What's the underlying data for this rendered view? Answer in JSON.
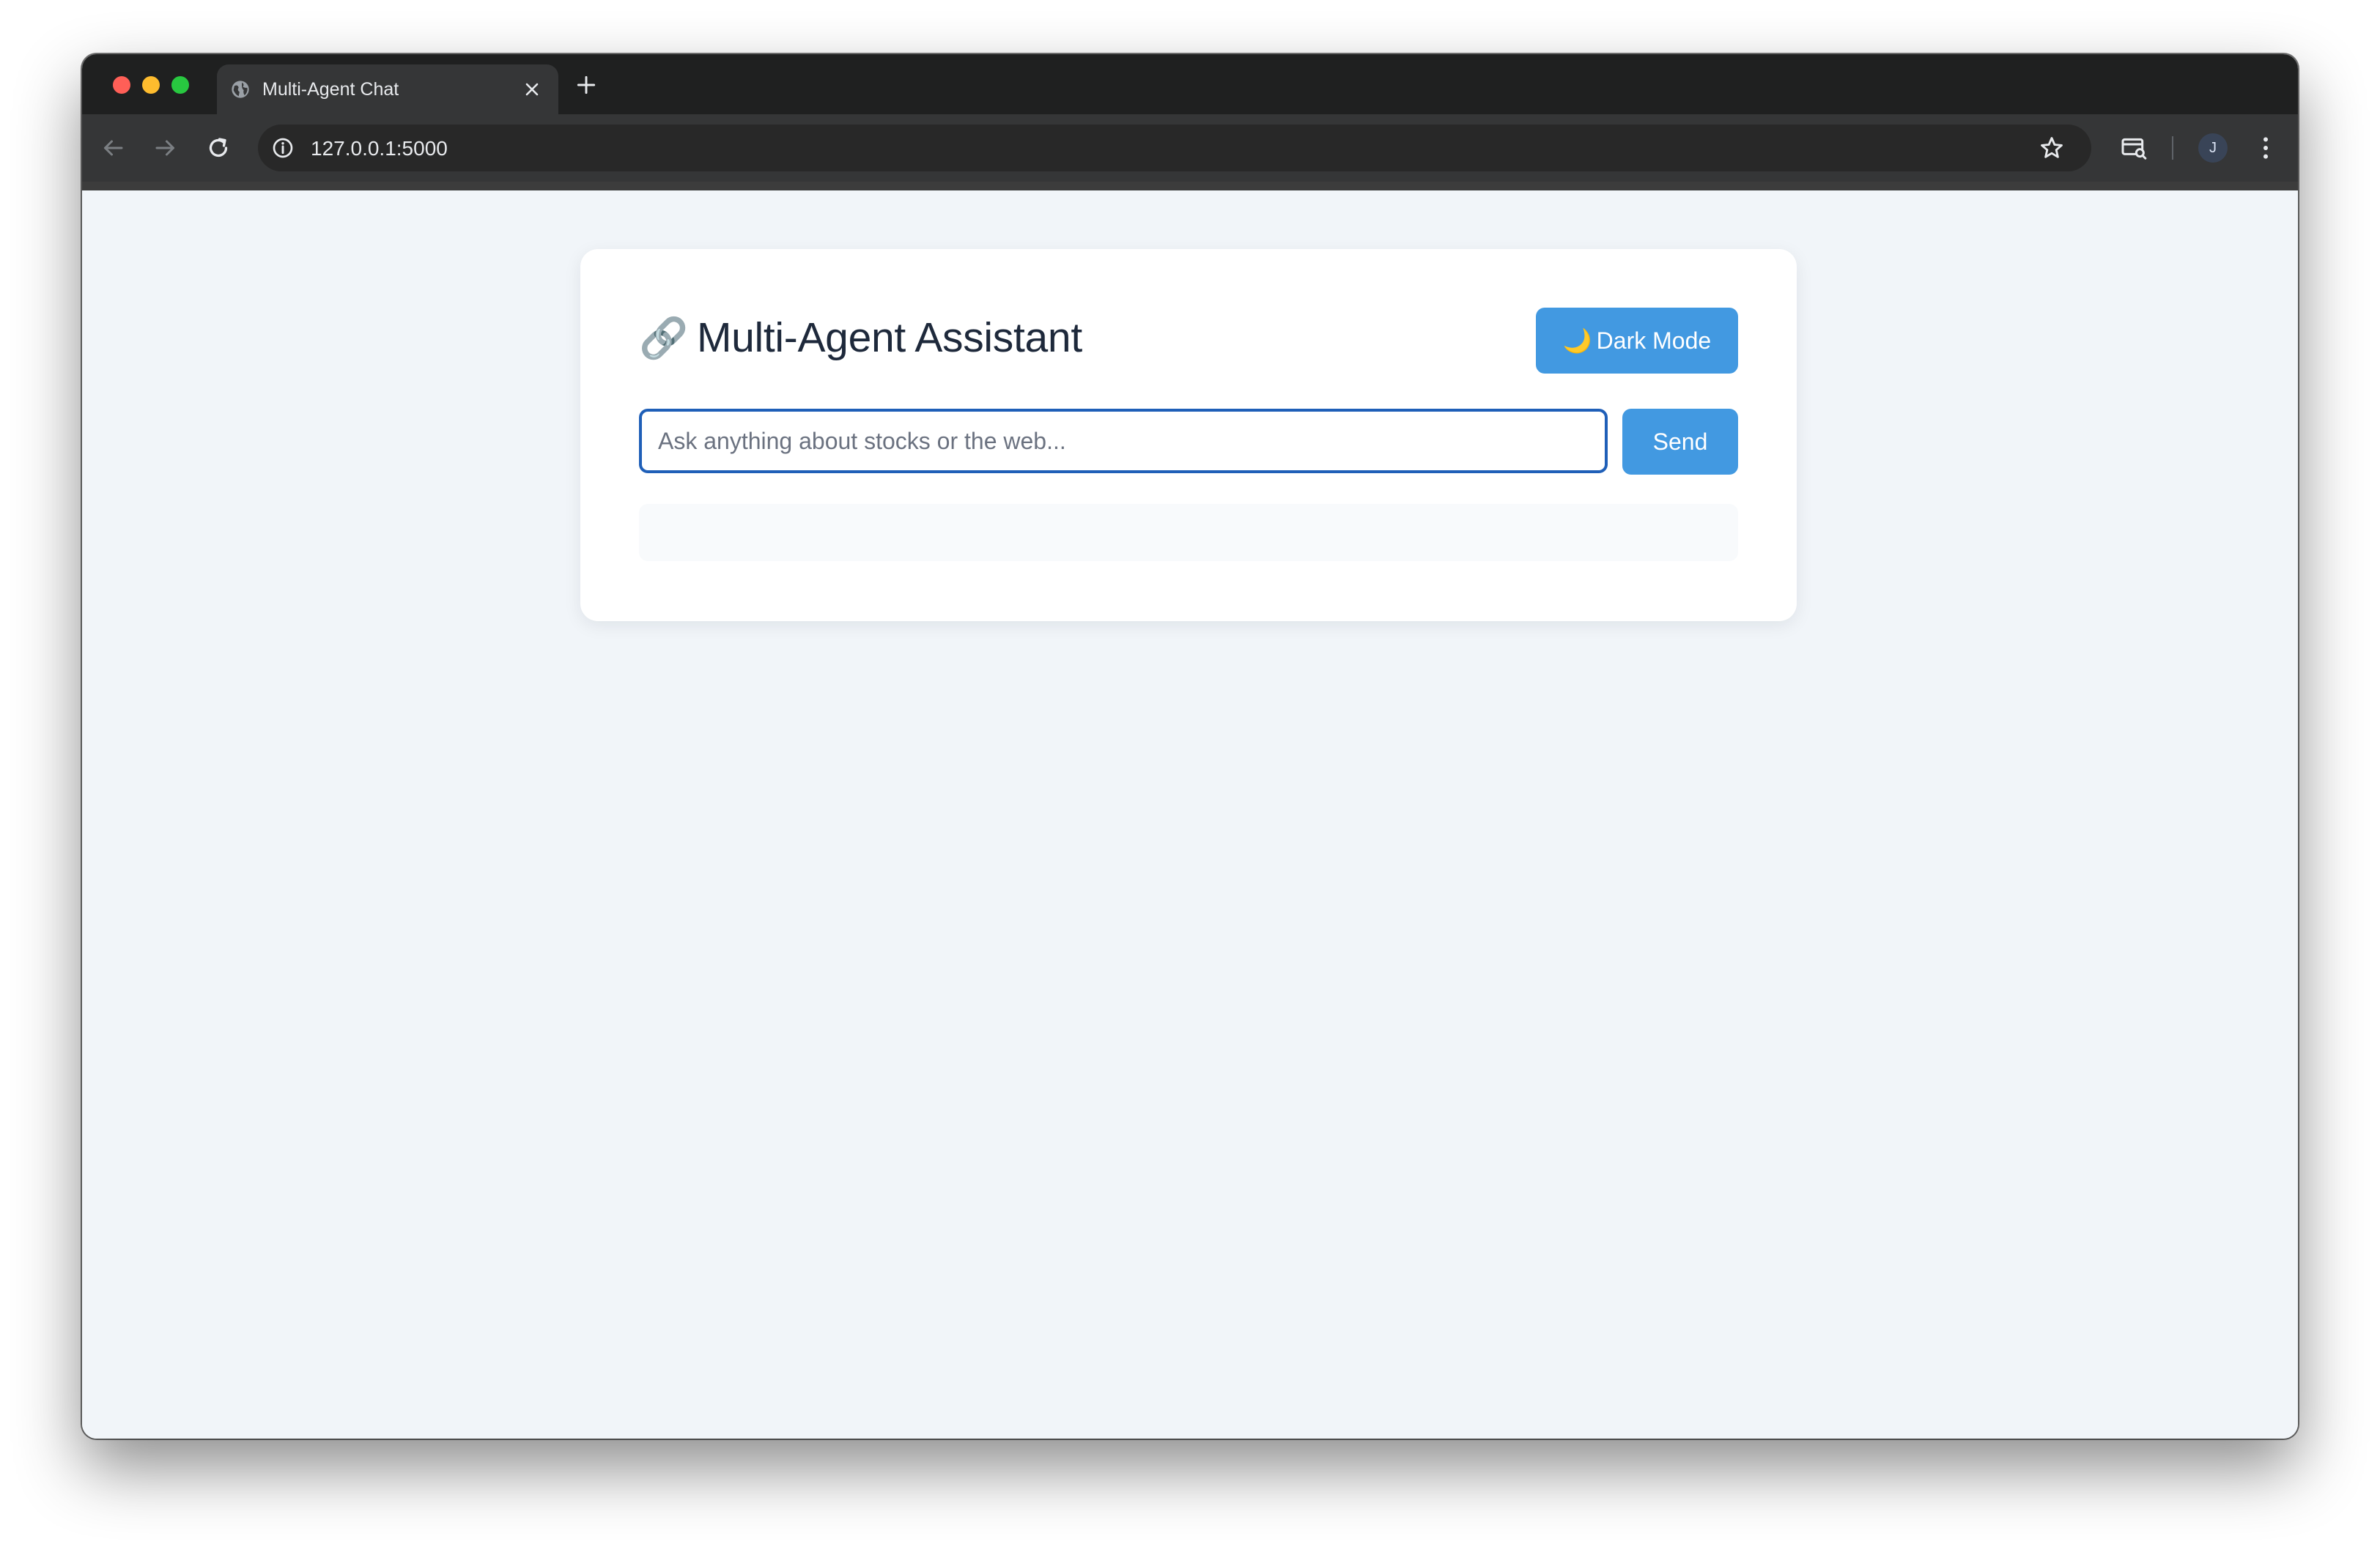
{
  "browser": {
    "tab": {
      "title": "Multi-Agent Chat"
    },
    "address_bar": {
      "url": "127.0.0.1:5000"
    },
    "profile": {
      "initial": "J"
    },
    "icons": {
      "tab_favicon": "globe-icon",
      "tab_close": "close-icon",
      "new_tab": "plus-icon",
      "back": "back-arrow-icon",
      "forward": "forward-arrow-icon",
      "reload": "reload-icon",
      "site_info": "info-icon",
      "bookmark": "star-icon",
      "reading_mode": "reading-mode-icon",
      "menu": "kebab-menu-icon"
    }
  },
  "app": {
    "title_icon": "🔗",
    "title": "Multi-Agent Assistant",
    "dark_mode_button": {
      "icon": "🌙",
      "label": "Dark Mode"
    },
    "chat": {
      "input_placeholder": "Ask anything about stocks or the web...",
      "input_value": "",
      "send_label": "Send"
    }
  },
  "colors": {
    "accent": "#4299e1",
    "input_focus_border": "#1f5fb8",
    "page_background": "#f1f5f9",
    "card_background": "#ffffff",
    "title_text": "#1e293b"
  }
}
